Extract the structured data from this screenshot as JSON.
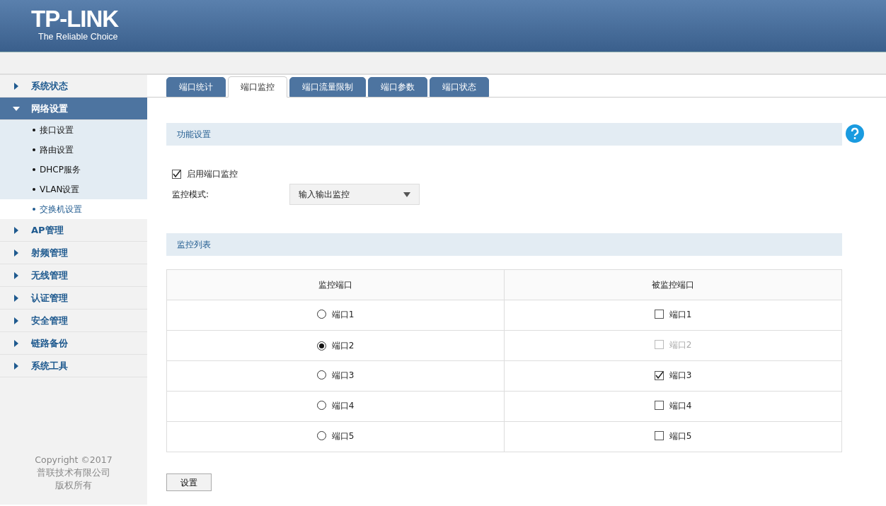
{
  "header": {
    "logo": "TP-LINK",
    "tagline": "The Reliable Choice"
  },
  "sidebar": {
    "items": [
      {
        "label": "系统状态",
        "expanded": false
      },
      {
        "label": "网络设置",
        "expanded": true,
        "children": [
          {
            "label": "接口设置",
            "selected": false
          },
          {
            "label": "路由设置",
            "selected": false
          },
          {
            "label": "DHCP服务",
            "selected": false
          },
          {
            "label": "VLAN设置",
            "selected": false
          },
          {
            "label": "交换机设置",
            "selected": true
          }
        ]
      },
      {
        "label": "AP管理",
        "expanded": false
      },
      {
        "label": "射频管理",
        "expanded": false
      },
      {
        "label": "无线管理",
        "expanded": false
      },
      {
        "label": "认证管理",
        "expanded": false
      },
      {
        "label": "安全管理",
        "expanded": false
      },
      {
        "label": "链路备份",
        "expanded": false
      },
      {
        "label": "系统工具",
        "expanded": false
      }
    ],
    "footer": [
      "Copyright ©2017",
      "普联技术有限公司",
      "版权所有"
    ]
  },
  "tabs": [
    {
      "label": "端口统计",
      "selected": false
    },
    {
      "label": "端口监控",
      "selected": true
    },
    {
      "label": "端口流量限制",
      "selected": false
    },
    {
      "label": "端口参数",
      "selected": false
    },
    {
      "label": "端口状态",
      "selected": false
    }
  ],
  "function_section": {
    "title": "功能设置",
    "enable": {
      "label": "启用端口监控",
      "checked": true
    },
    "mode": {
      "label": "监控模式:",
      "value": "输入输出监控"
    }
  },
  "list_section": {
    "title": "监控列表",
    "columns": [
      "监控端口",
      "被监控端口"
    ],
    "rows": [
      {
        "monitor": {
          "label": "端口1",
          "selected": false
        },
        "monitored": {
          "label": "端口1",
          "checked": false,
          "disabled": false
        }
      },
      {
        "monitor": {
          "label": "端口2",
          "selected": true
        },
        "monitored": {
          "label": "端口2",
          "checked": false,
          "disabled": true
        }
      },
      {
        "monitor": {
          "label": "端口3",
          "selected": false
        },
        "monitored": {
          "label": "端口3",
          "checked": true,
          "disabled": false
        }
      },
      {
        "monitor": {
          "label": "端口4",
          "selected": false
        },
        "monitored": {
          "label": "端口4",
          "checked": false,
          "disabled": false
        }
      },
      {
        "monitor": {
          "label": "端口5",
          "selected": false
        },
        "monitored": {
          "label": "端口5",
          "checked": false,
          "disabled": false
        }
      }
    ]
  },
  "buttons": [
    "设置"
  ]
}
